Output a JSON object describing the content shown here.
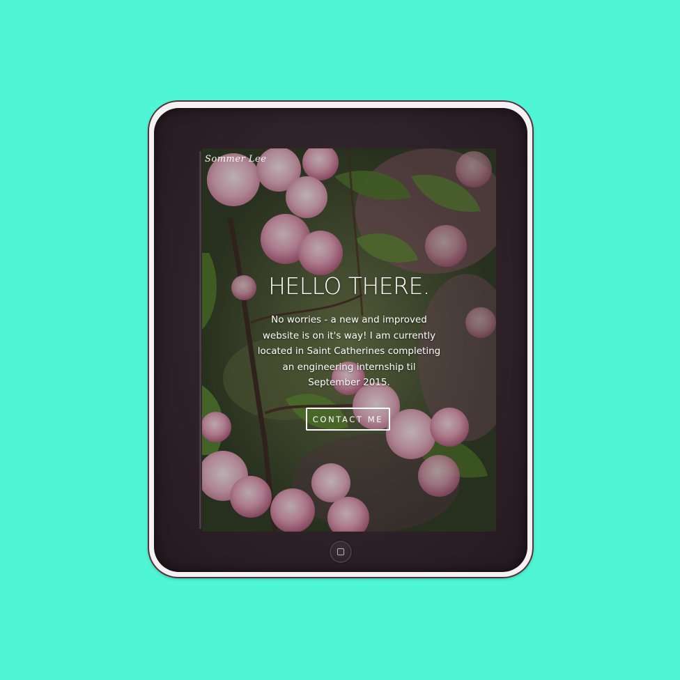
{
  "page": {
    "background_color": "#4ff6d6"
  },
  "device": {
    "type": "tablet",
    "home_button_icon": "home-square-icon"
  },
  "site": {
    "brand": "Sommer Lee",
    "hero": {
      "title": "HELLO THERE.",
      "message": "No worries - a new and improved website is on it's way! I am currently located in Saint Catherines completing an engineering internship til September 2015.",
      "button_label": "CONTACT ME"
    },
    "background_image": "pink cherry blossom branches"
  }
}
